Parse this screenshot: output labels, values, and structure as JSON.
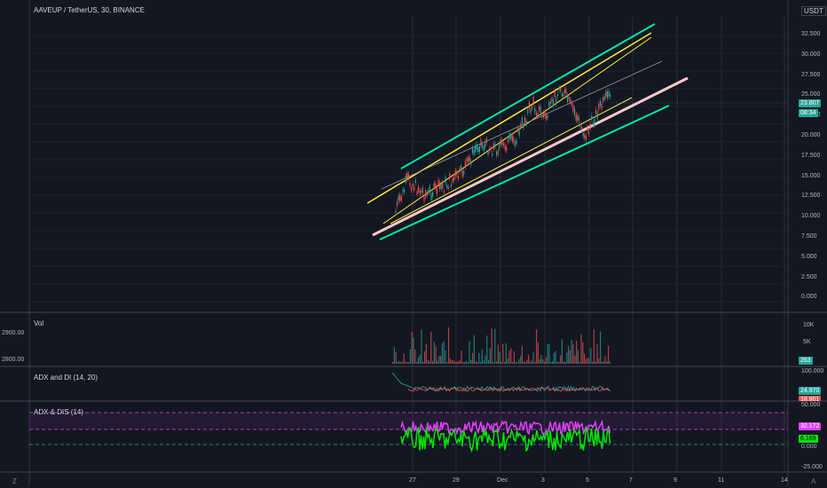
{
  "header": {
    "symbol_label": "AAVEUP / TetherUS, 30, BINANCE"
  },
  "currency": "USDT",
  "colors": {
    "background": "#131722",
    "grid": "#2a2e39",
    "green": "#26a69a",
    "red": "#ef5350",
    "aqua_channel": "#00e6a8",
    "yellow_channel": "#ffeb3b",
    "pink_line": "#ffc9c9",
    "magenta": "#e040fb",
    "lime": "#00e600"
  },
  "main_chart": {
    "price_ticks": [
      "32.500",
      "30.000",
      "27.500",
      "25.000",
      "22.500",
      "20.000",
      "17.500",
      "15.000",
      "12.500",
      "10.000",
      "7.500",
      "5.000",
      "2.500",
      "0.000"
    ],
    "last_price": "23.807",
    "countdown": "08:34"
  },
  "volume_pane": {
    "label": "Vol",
    "left_ticks": [
      "2900.00",
      "2800.00"
    ],
    "right_ticks": [
      "10K",
      "5K"
    ],
    "last_value": "263"
  },
  "adx_pane": {
    "label": "ADX and DI (14, 20)",
    "right_tick": "100.000",
    "value_green": "24.970",
    "value_red": "18.801"
  },
  "adx_dis_pane": {
    "label": "ADX & DIS (14)",
    "right_ticks": [
      "50.000",
      "0.000",
      "-25.000"
    ],
    "value_magenta": "32.172",
    "value_green": "6.169"
  },
  "time_axis": {
    "labels": [
      "27",
      "29",
      "Dec",
      "3",
      "5",
      "7",
      "9",
      "11",
      "14"
    ]
  },
  "bottom_icons": {
    "left": "Z",
    "right": "A"
  }
}
